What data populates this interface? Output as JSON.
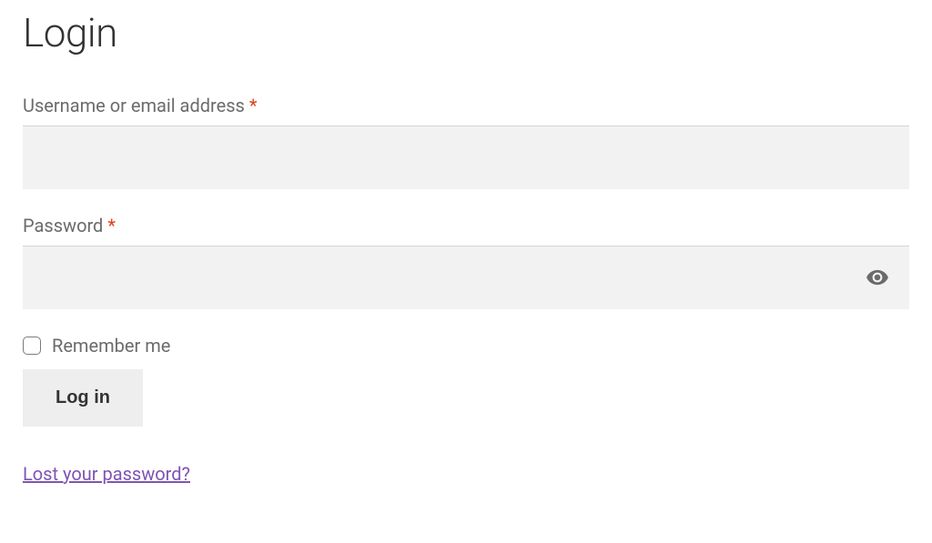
{
  "title": "Login",
  "fields": {
    "username": {
      "label": "Username or email address ",
      "required": "*",
      "value": ""
    },
    "password": {
      "label": "Password ",
      "required": "*",
      "value": ""
    }
  },
  "remember": {
    "label": "Remember me"
  },
  "submit": {
    "label": "Log in"
  },
  "lost_password": {
    "label": "Lost your password?"
  }
}
